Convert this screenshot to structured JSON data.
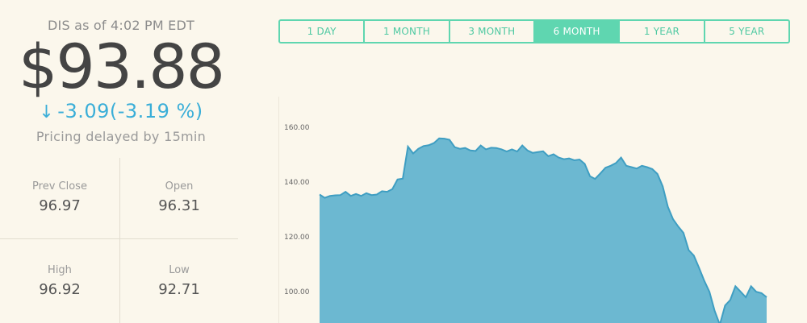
{
  "quote": {
    "ticker_line": "DIS as of 4:02 PM EDT",
    "price": "$93.88",
    "change_arrow": "↓",
    "change": "-3.09",
    "change_pct": "(-3.19 %)",
    "delay_note": "Pricing delayed by 15min",
    "direction_color": "#3aaed8"
  },
  "stats": {
    "prev_close_label": "Prev Close",
    "prev_close": "96.97",
    "open_label": "Open",
    "open": "96.31",
    "high_label": "High",
    "high": "96.92",
    "low_label": "Low",
    "low": "92.71"
  },
  "ranges": {
    "items": [
      "1 DAY",
      "1 MONTH",
      "3 MONTH",
      "6 MONTH",
      "1 YEAR",
      "5 YEAR"
    ],
    "selected": "6 MONTH",
    "accent": "#5fd6b0"
  },
  "chart_data": {
    "type": "area",
    "y_tick_labels": [
      "160.00",
      "140.00",
      "120.00",
      "100.00"
    ],
    "ylim": [
      92,
      165
    ],
    "grid": false,
    "fill_color": "#6cb8d1",
    "line_color": "#3f9ec2",
    "values": [
      132.5,
      131.3,
      132,
      132.2,
      132.3,
      133.5,
      132,
      132.7,
      132,
      133,
      132.3,
      132.5,
      133.7,
      133.5,
      134.5,
      138,
      138.3,
      150,
      147.5,
      149.2,
      150.2,
      150.5,
      151.3,
      153,
      152.9,
      152.5,
      149.8,
      149.2,
      149.5,
      148.6,
      148.4,
      150.4,
      149,
      149.6,
      149.5,
      149,
      148.2,
      149,
      148.2,
      150.4,
      148.6,
      147.7,
      148,
      148.3,
      146.5,
      147.2,
      146,
      145.4,
      145.7,
      145,
      145.3,
      143.7,
      139.2,
      138.2,
      140.2,
      142.3,
      143,
      144,
      146,
      143,
      142.5,
      142,
      143,
      142.5,
      141.8,
      140,
      135.5,
      128,
      123.5,
      120.8,
      118.5,
      112.2,
      110.2,
      105.7,
      101,
      97,
      90,
      85,
      92,
      94,
      99,
      97,
      95,
      99,
      97,
      96.5,
      95
    ]
  }
}
